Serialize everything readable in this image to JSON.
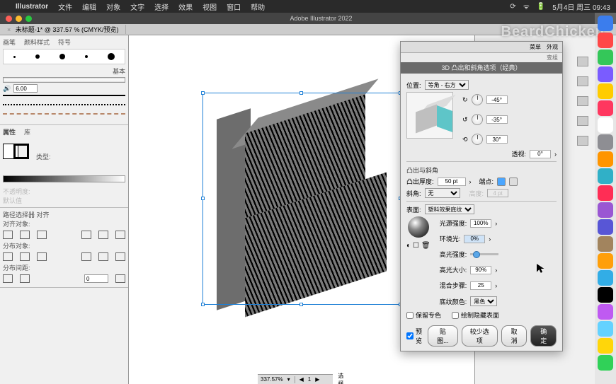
{
  "menubar": {
    "app": "Illustrator",
    "items": [
      "文件",
      "编辑",
      "对象",
      "文字",
      "选择",
      "效果",
      "视图",
      "窗口",
      "帮助"
    ],
    "date": "5月4日 周三 09:43"
  },
  "window": {
    "title": "Adobe Illustrator 2022"
  },
  "tab": {
    "label": "未标题-1* @ 337.57 % (CMYK/预览)"
  },
  "watermark": "BeardChicken",
  "left": {
    "brush_tabs": [
      "画笔",
      "颜料样式",
      "符号"
    ],
    "basic_label": "基本",
    "size_value": "6.00",
    "prop_tabs": [
      "属性",
      "库"
    ],
    "type_label": "类型:",
    "transparency_label": "不透明度:",
    "default_label": "默认值",
    "align_title": "路径选择器 对齐",
    "align_obj": "对齐对象:",
    "distribute": "分布对象:",
    "spacing": "分布间距:",
    "spacing_val": "0"
  },
  "dialog": {
    "title": "3D 凸出和斜角选项（经典）",
    "tabs": [
      "菜单",
      "外观"
    ],
    "sub": "变组",
    "position_label": "位置:",
    "position_value": "等角 - 右方",
    "rot_x": "-45°",
    "rot_y": "-35°",
    "rot_z": "30°",
    "perspective_label": "透视:",
    "perspective_value": "0°",
    "extrude_section": "凸出与斜角",
    "depth_label": "凸出厚度:",
    "depth_value": "50 pt",
    "cap_label": "端点:",
    "bevel_label": "斜角:",
    "bevel_value": "无",
    "bevel_h_label": "高度:",
    "bevel_h_value": "4 pt",
    "surface_label": "表面:",
    "surface_value": "塑料效果底纹",
    "light_intensity_label": "光源强度:",
    "light_intensity_value": "100%",
    "ambient_label": "环境光:",
    "ambient_value": "0%",
    "highlight_label": "高光强度:",
    "highlight_size_label": "高光大小:",
    "highlight_size_value": "90%",
    "blend_steps_label": "混合步骤:",
    "blend_steps_value": "25",
    "shade_color_label": "底纹颜色:",
    "shade_color_value": "黑色",
    "preserve_spot": "保留专色",
    "draw_hidden": "绘制隐藏表面",
    "preview": "预览",
    "map_art": "贴图...",
    "fewer": "较少选项",
    "cancel": "取消",
    "ok": "确定"
  },
  "status": {
    "zoom": "337.57%",
    "tool": "选择"
  },
  "dock_colors": [
    "#3b7ded",
    "#ff4747",
    "#34c759",
    "#7a5cff",
    "#ffcc00",
    "#ff375f",
    "#ffffff",
    "#8e8e93",
    "#ff9500",
    "#30b0c7",
    "#ff2d55",
    "#9a57d3",
    "#5856d6",
    "#a2845e",
    "#ff9f0a",
    "#32ade6",
    "#000",
    "#bf5af2",
    "#64d2ff",
    "#ffd60a",
    "#30d158"
  ]
}
